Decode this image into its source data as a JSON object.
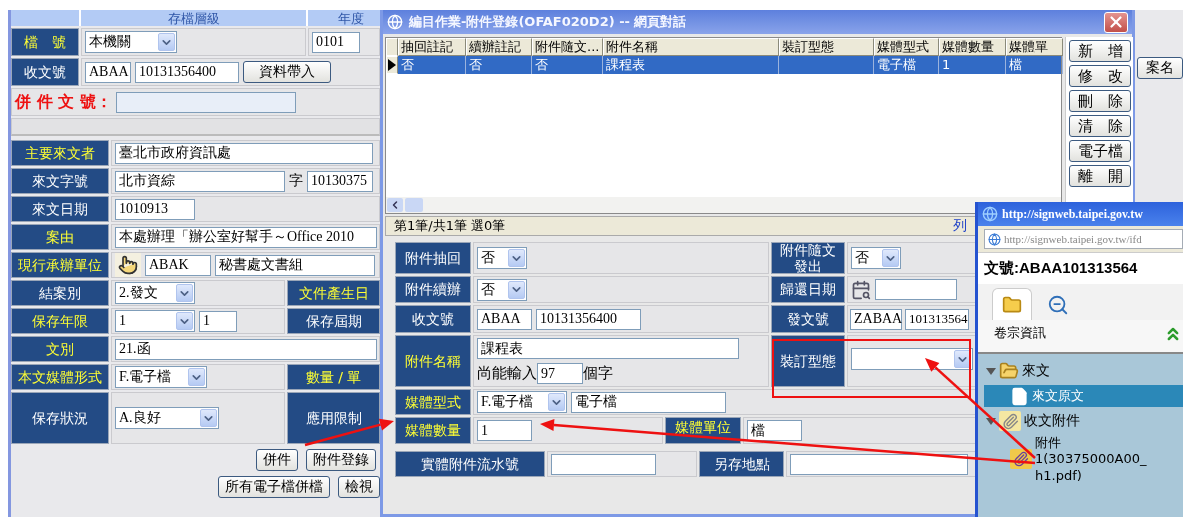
{
  "main_form": {
    "header": [
      "存檔層級",
      "年度"
    ],
    "file_no": {
      "label": {
        "text": "檔　號",
        "required": true
      },
      "level": "本機關",
      "year": "0101"
    },
    "receipt_no": {
      "label": {
        "text": "收文號",
        "required": false
      },
      "prefix": "ABAA",
      "number": "10131356400",
      "button": "資料帶入"
    },
    "merge_no": {
      "label": "併 件 文 號："
    },
    "sender": {
      "label": {
        "text": "主要來文者",
        "required": true
      },
      "value": "臺北市政府資訊處"
    },
    "sender_ref": {
      "label": {
        "text": "來文字號",
        "required": false
      },
      "value": "北市資綜",
      "suffix": "字",
      "number": "10130375"
    },
    "date": {
      "label": {
        "text": "來文日期",
        "required": false
      },
      "value": "1010913"
    },
    "subject": {
      "label": {
        "text": "案由",
        "required": true
      },
      "value": "本處辦理「辦公室好幫手～Office 2010"
    },
    "unit": {
      "label": {
        "text": "現行承辦單位",
        "required": true
      },
      "code": "ABAK",
      "name": "秘書處文書組"
    },
    "closing": {
      "label": {
        "text": "結案別",
        "required": false
      },
      "value": "2.發文",
      "side_label": {
        "text": "文件產生日",
        "required": true
      }
    },
    "retention": {
      "label": {
        "text": "保存年限",
        "required": true
      },
      "value": "1",
      "years": "1",
      "side_label": {
        "text": "保存屆期",
        "required": false
      }
    },
    "doc_type": {
      "label": {
        "text": "文別",
        "required": true
      },
      "value": "21.函"
    },
    "media": {
      "label": {
        "text": "本文媒體形式",
        "required": true
      },
      "value": "F.電子檔",
      "side_label": {
        "text": "數量 / 單",
        "required": true
      }
    },
    "condition": {
      "label": {
        "text": "保存狀況",
        "required": false
      },
      "value": "A.良好",
      "side_label": {
        "text": "應用限制",
        "required": false
      }
    },
    "buttons": [
      "併件",
      "附件登錄"
    ],
    "buttons_2": [
      "所有電子檔併檔",
      "檢視"
    ],
    "side_button": "案名"
  },
  "dialog": {
    "title": "編目作業-附件登錄(OFAF020D2) -- 網頁對話",
    "grid": {
      "columns": [
        "抽回註記",
        "續辦註記",
        "附件隨文...",
        "附件名稱",
        "裝訂型態",
        "媒體型式",
        "媒體數量",
        "媒體單"
      ],
      "rows": [
        {
          "selected": true,
          "cells": [
            "否",
            "否",
            "否",
            "課程表",
            null,
            "電子檔",
            "1",
            "檔"
          ]
        }
      ]
    },
    "status": "第1筆/共1筆 選0筆",
    "print_link": "列",
    "actions": [
      "新　增",
      "修　改",
      "刪　除",
      "清　除",
      "電子檔",
      "離　開"
    ],
    "form": {
      "withdrawn": {
        "label": {
          "text": "附件抽回",
          "required": false
        },
        "value": "否"
      },
      "sent_with": {
        "label": {
          "text": "附件隨文發出",
          "required": false
        },
        "value": "否"
      },
      "continued": {
        "label": {
          "text": "附件續辦",
          "required": false
        },
        "value": "否"
      },
      "return_date": {
        "label": {
          "text": "歸還日期",
          "required": false
        }
      },
      "receipt": {
        "label": {
          "text": "收文號",
          "required": false
        },
        "prefix": "ABAA",
        "number": "10131356400"
      },
      "dispatch": {
        "label": {
          "text": "發文號",
          "required": false
        },
        "prefix": "ZABAA",
        "number": "101313564"
      },
      "name": {
        "label": {
          "text": "附件名稱",
          "required": true
        },
        "value": "課程表",
        "remaining_prefix": "尚能輸入",
        "remaining": "97",
        "remaining_suffix": "個字"
      },
      "binding": {
        "label": {
          "text": "裝訂型態",
          "required": false
        }
      },
      "media_type": {
        "label": {
          "text": "媒體型式",
          "required": true
        },
        "value": "F.電子檔",
        "description": "電子檔"
      },
      "media_count": {
        "label": {
          "text": "媒體數量",
          "required": true
        },
        "value": "1"
      },
      "media_unit": {
        "label": {
          "text": "媒體單位",
          "required": true
        },
        "value": "檔"
      },
      "serial": {
        "label": {
          "text": "實體附件流水號",
          "required": false
        }
      },
      "location": {
        "label": {
          "text": "另存地點",
          "required": false
        }
      }
    }
  },
  "popup": {
    "title": "http://signweb.taipei.gov.tw",
    "address": "http://signweb.taipei.gov.tw/ifd",
    "doc_no": "文號:ABAA101313564",
    "tabs": [
      {
        "kind": "folder",
        "selected": true
      },
      {
        "kind": "zoom",
        "selected": false
      }
    ],
    "section": "卷宗資訊",
    "tree": [
      {
        "kind": "folder",
        "label": "來文",
        "expanded": true,
        "selected": false,
        "children": [
          {
            "kind": "document",
            "label": "來文原文",
            "selected": true
          }
        ]
      },
      {
        "kind": "clip",
        "label": "收文附件",
        "expanded": true,
        "selected": false,
        "children": [
          {
            "kind": "attachment",
            "label": "附件 1(30375000A00_ h1.pdf)",
            "selected": false
          }
        ]
      }
    ]
  }
}
